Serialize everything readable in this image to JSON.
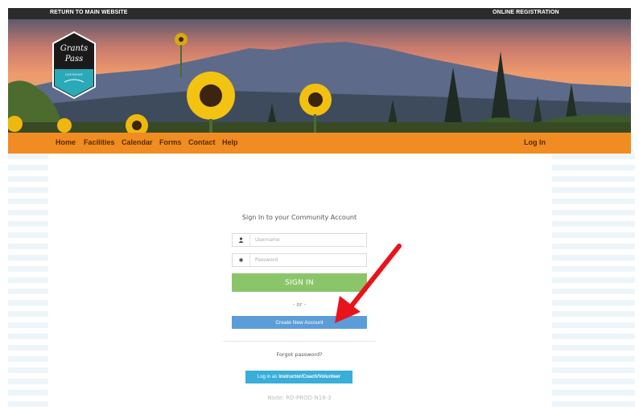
{
  "topbar": {
    "return_link": "RETURN TO MAIN WEBSITE",
    "registration_link": "ONLINE REGISTRATION"
  },
  "logo": {
    "line1": "Grants",
    "line2": "Pass",
    "tagline": "LIVE ROGUE"
  },
  "nav": {
    "items": [
      "Home",
      "Facilities",
      "Calendar",
      "Forms",
      "Contact",
      "Help"
    ],
    "login": "Log In"
  },
  "login": {
    "title": "Sign In to your Community Account",
    "username_placeholder": "Username",
    "password_placeholder": "Password",
    "sign_in": "SIGN IN",
    "or": "- or -",
    "create_account": "Create New Account",
    "forgot": "Forgot password?",
    "instructor_prefix": "Log in as",
    "instructor_bold": "Instructor/Coach/Volunteer",
    "node": "Node: RD-PROD-N16-3"
  },
  "colors": {
    "topbar": "#2b2b2b",
    "nav": "#f08c22",
    "sign_in": "#8bc56a",
    "create": "#5b9dd9",
    "instructor": "#39aed8",
    "arrow": "#e8141c"
  },
  "icons": {
    "username": "user-icon",
    "password": "asterisk-icon",
    "annotation": "red-arrow-icon"
  }
}
